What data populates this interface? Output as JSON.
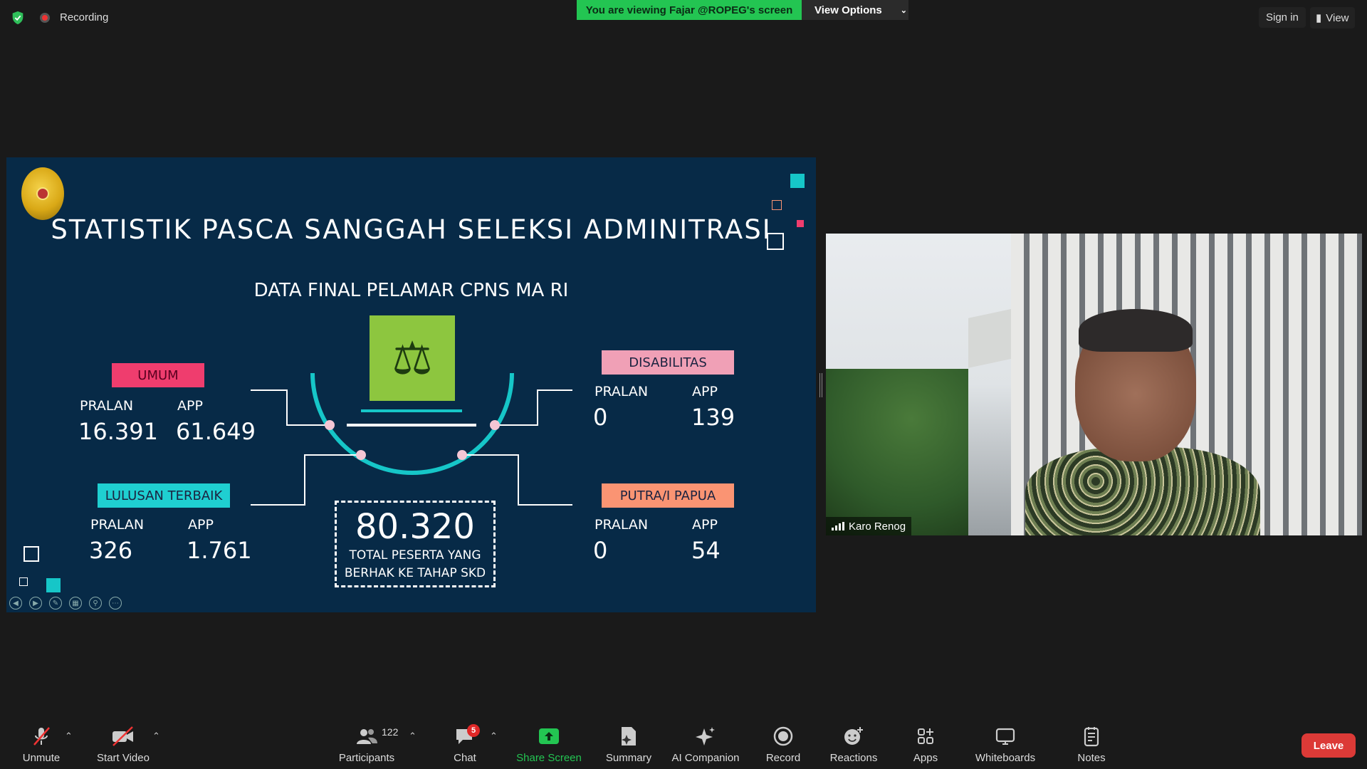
{
  "topbar": {
    "recording_label": "Recording",
    "viewing_banner": "You are viewing Fajar @ROPEG's screen",
    "view_options_label": "View Options",
    "signin_label": "Sign in",
    "view_label": "View"
  },
  "slide": {
    "title": "STATISTIK PASCA SANGGAH SELEKSI ADMINITRASI",
    "subtitle": "DATA FINAL PELAMAR CPNS MA RI",
    "col_pralan": "PRALAN",
    "col_app": "APP",
    "categories": [
      {
        "label": "UMUM",
        "pralan": "16.391",
        "app": "61.649"
      },
      {
        "label": "DISABILITAS",
        "pralan": "0",
        "app": "139"
      },
      {
        "label": "LULUSAN TERBAIK",
        "pralan": "326",
        "app": "1.761"
      },
      {
        "label": "PUTRA/I PAPUA",
        "pralan": "0",
        "app": "54"
      }
    ],
    "total": {
      "value": "80.320",
      "caption_line1": "TOTAL PESERTA YANG",
      "caption_line2": "BERHAK KE TAHAP SKD"
    }
  },
  "video": {
    "participant_name": "Karo Renog"
  },
  "toolbar": {
    "unmute": "Unmute",
    "start_video": "Start Video",
    "participants": "Participants",
    "participants_count": "122",
    "chat": "Chat",
    "chat_badge": "5",
    "share_screen": "Share Screen",
    "summary": "Summary",
    "ai_companion": "AI Companion",
    "record": "Record",
    "reactions": "Reactions",
    "apps": "Apps",
    "whiteboards": "Whiteboards",
    "notes": "Notes",
    "leave": "Leave"
  },
  "colors": {
    "banner_green": "#23c552",
    "share_green": "#23c552",
    "leave_red": "#dc3a37",
    "slide_bg": "#072a47",
    "accent_teal": "#1fcfd1"
  }
}
